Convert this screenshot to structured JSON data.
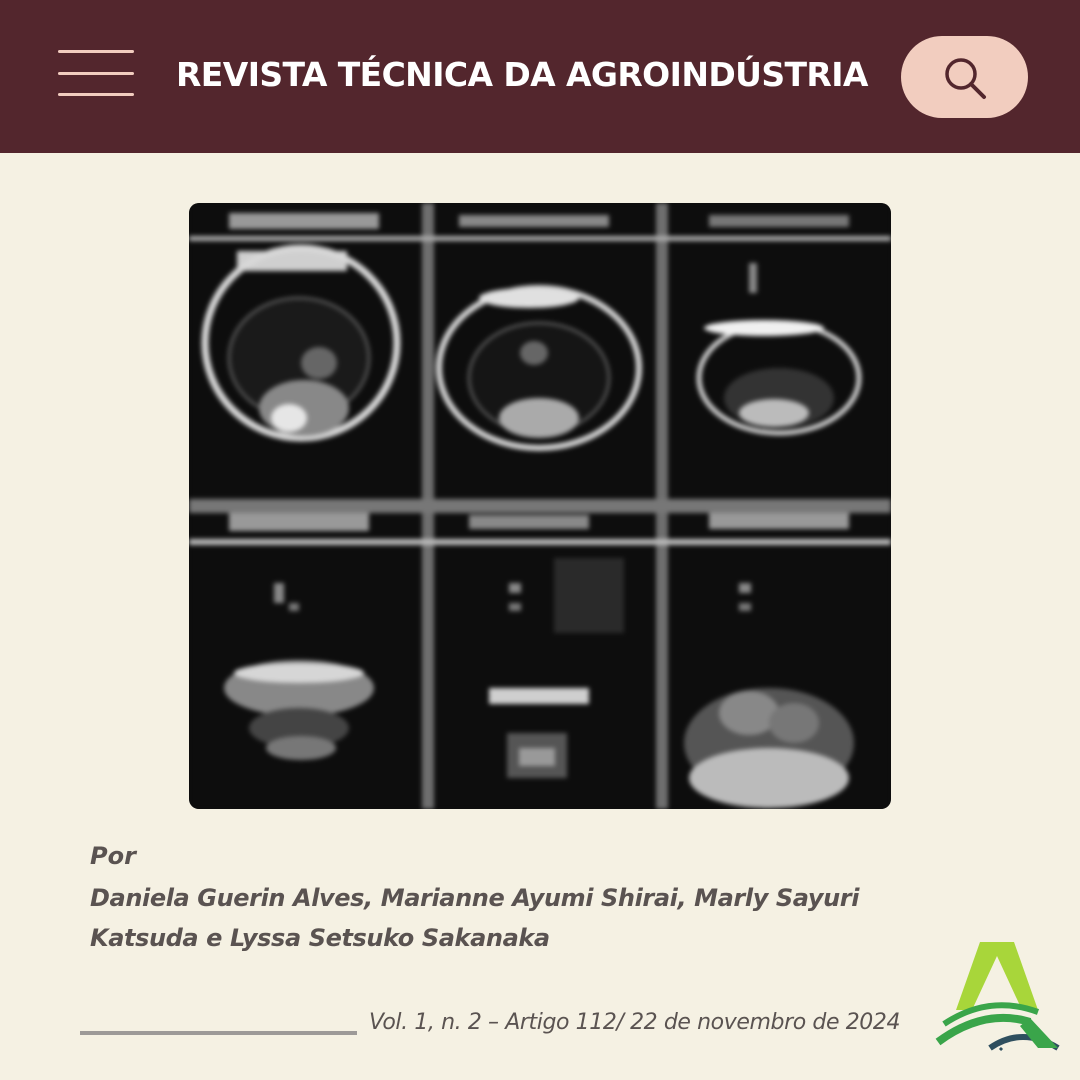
{
  "header": {
    "title": "REVISTA TÉCNICA DA AGROINDÚSTRIA",
    "menu_icon": "hamburger-menu-icon",
    "search_icon": "search-icon",
    "background_color": "#53262d",
    "accent_color": "#f2cdbf"
  },
  "article": {
    "image_description_icon": "mri-scan-grid-image",
    "by_label": "Por",
    "authors": "Daniela Guerin Alves, Marianne Ayumi Shirai, Marly Sayuri Katsuda e Lyssa Setsuko Sakanaka",
    "citation": "Vol. 1, n. 2 – Artigo 112/ 22 de novembro de 2024"
  },
  "footer": {
    "logo_icon": "agroindustria-logo-icon",
    "logo_colors": [
      "#a8d63a",
      "#3aa54a",
      "#2f4f5f"
    ]
  }
}
